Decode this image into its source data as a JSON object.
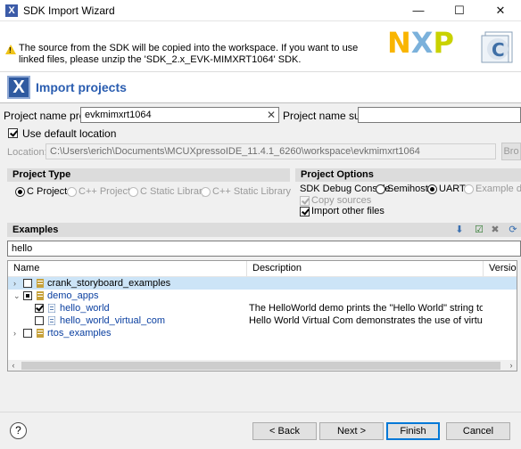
{
  "window": {
    "title": "SDK Import Wizard",
    "minimize": "—",
    "maximize": "☐",
    "close": "✕"
  },
  "header": {
    "message": "The source from the SDK will be copied into the workspace. If you want to use linked files, please unzip the 'SDK_2.x_EVK-MIMXRT1064' SDK.",
    "logo_letters": [
      "N",
      "X",
      "P"
    ],
    "logo_colors": [
      "#f9b500",
      "#7bb1db",
      "#c9d200"
    ],
    "doc_letter": "C"
  },
  "banner": {
    "title": "Import projects"
  },
  "form": {
    "prefix_label": "Project name prefix:",
    "prefix_value": "evkmimxrt1064",
    "clear": "✕",
    "suffix_label": "Project name suffix:",
    "suffix_value": "",
    "default_location_label": "Use default location",
    "location_label": "Location:",
    "location_value": "C:\\Users\\erich\\Documents\\MCUXpressoIDE_11.4.1_6260\\workspace\\evkmimxrt1064",
    "browse_label": "Bro"
  },
  "project_type": {
    "title": "Project Type",
    "options": [
      "C Project",
      "C++ Project",
      "C Static Library",
      "C++ Static Library"
    ],
    "selected": "C Project"
  },
  "project_options": {
    "title": "Project Options",
    "debug_console_label": "SDK Debug Console",
    "debug_console_options": [
      "Semihost",
      "UART",
      "Example de"
    ],
    "debug_console_selected": "UART",
    "copy_sources": "Copy sources",
    "import_other_files": "Import other files"
  },
  "examples": {
    "title": "Examples",
    "filter": "hello",
    "columns": {
      "name": "Name",
      "description": "Description",
      "version": "Version"
    },
    "rows": [
      {
        "name": "crank_storyboard_examples",
        "description": "",
        "selected": true
      },
      {
        "name": "demo_apps",
        "description": ""
      },
      {
        "name": "hello_world",
        "description": "The HelloWorld demo prints the \"Hello World\" string to the te..."
      },
      {
        "name": "hello_world_virtual_com",
        "description": "Hello World Virtual Com demonstrates the use of virtual com ..."
      },
      {
        "name": "rtos_examples",
        "description": ""
      }
    ]
  },
  "buttons": {
    "help": "?",
    "back": "< Back",
    "next": "Next >",
    "finish": "Finish",
    "cancel": "Cancel"
  },
  "colors": {
    "accent": "#0078d7",
    "banner_title": "#2a5db0",
    "selection": "#cce4f7"
  }
}
